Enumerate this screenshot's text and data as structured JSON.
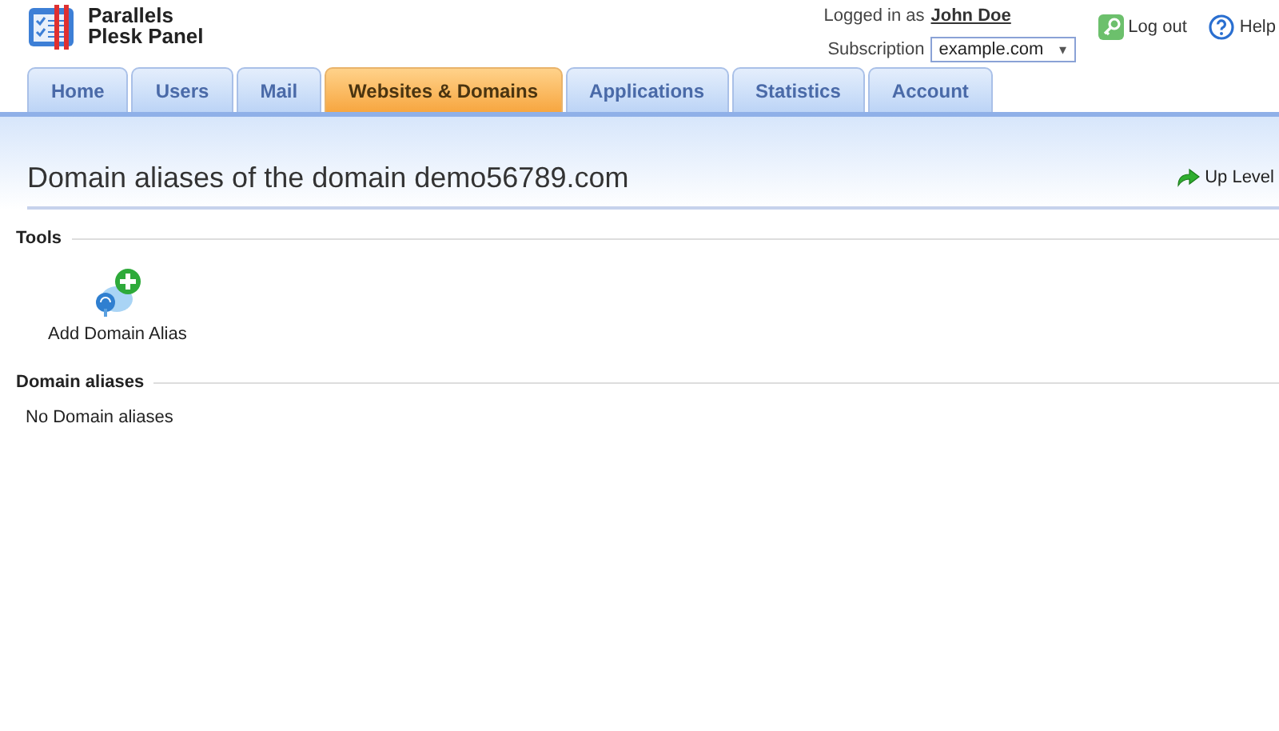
{
  "brand": {
    "line_1": "Parallels",
    "line_2": "Plesk Panel"
  },
  "user": {
    "logged_in_label": "Logged in as",
    "name": "John Doe",
    "subscription_label": "Subscription",
    "subscription": "example.com",
    "caret": "▾"
  },
  "links": [
    {
      "kind": "logout",
      "label": "Log out"
    },
    {
      "kind": "help",
      "label": "Help"
    }
  ],
  "tabs": [
    {
      "label": "Home",
      "selected": false
    },
    {
      "label": "Users",
      "selected": false
    },
    {
      "label": "Mail",
      "selected": false
    },
    {
      "label": "Websites & Domains",
      "selected": true
    },
    {
      "label": "Applications",
      "selected": false
    },
    {
      "label": "Statistics",
      "selected": false
    },
    {
      "label": "Account",
      "selected": false
    }
  ],
  "page": {
    "title": "Domain aliases of the domain demo56789.com",
    "up_level": "Up Level"
  },
  "sections": [
    {
      "kind": "tools",
      "title": "Tools",
      "tools": [
        {
          "label": "Add Domain Alias"
        }
      ]
    },
    {
      "kind": "list",
      "title": "Domain aliases",
      "empty_text": "No Domain aliases"
    }
  ]
}
